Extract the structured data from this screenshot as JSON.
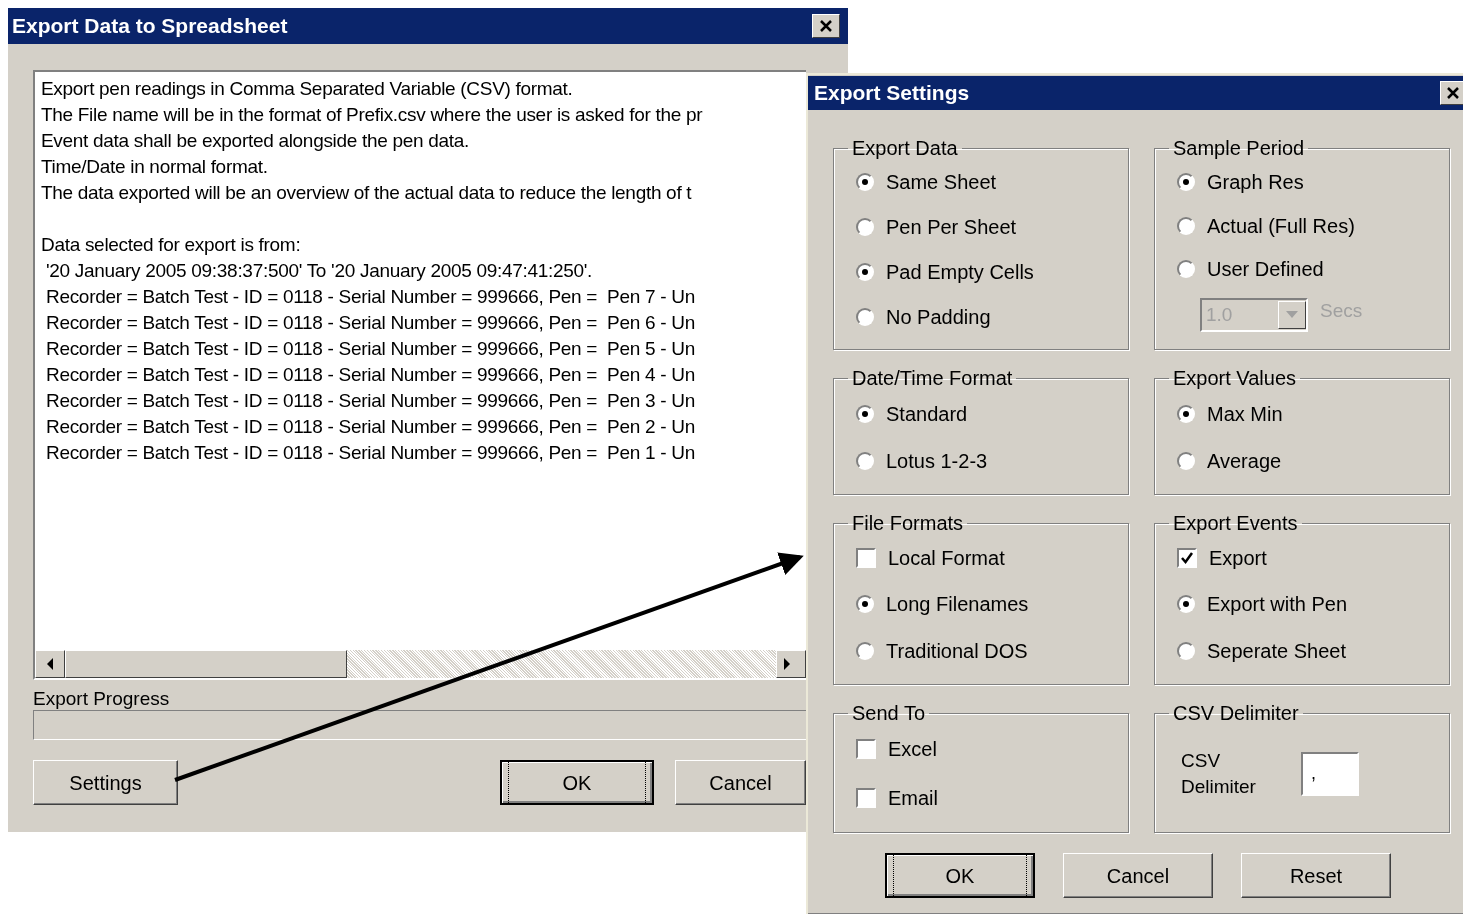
{
  "export_dialog": {
    "title": "Export Data to Spreadsheet",
    "description_lines": [
      "Export pen readings in Comma Separated Variable (CSV) format.",
      "The File name will be in the format of Prefix.csv where the user is asked for the pr",
      "Event data shall be exported alongside the pen data.",
      "Time/Date in normal format.",
      "The data exported will be an overview of the actual data to reduce the length of t"
    ],
    "selection_lines": [
      "Data selected for export is from:",
      " '20 January 2005 09:38:37:500' To '20 January 2005 09:47:41:250'.",
      " Recorder = Batch Test - ID = 0118 - Serial Number = 999666, Pen =  Pen 7 - Un",
      " Recorder = Batch Test - ID = 0118 - Serial Number = 999666, Pen =  Pen 6 - Un",
      " Recorder = Batch Test - ID = 0118 - Serial Number = 999666, Pen =  Pen 5 - Un",
      " Recorder = Batch Test - ID = 0118 - Serial Number = 999666, Pen =  Pen 4 - Un",
      " Recorder = Batch Test - ID = 0118 - Serial Number = 999666, Pen =  Pen 3 - Un",
      " Recorder = Batch Test - ID = 0118 - Serial Number = 999666, Pen =  Pen 2 - Un",
      " Recorder = Batch Test - ID = 0118 - Serial Number = 999666, Pen =  Pen 1 - Un"
    ],
    "progress_label": "Export Progress",
    "progress": {
      "level": 0
    },
    "buttons": [
      {
        "label": "Settings",
        "default": false
      },
      {
        "label": "OK",
        "default": true
      },
      {
        "label": "Cancel",
        "default": false
      }
    ]
  },
  "settings_dialog": {
    "title": "Export Settings",
    "groups": [
      {
        "title": "Export Data",
        "items": [
          {
            "kind": "radio",
            "label": "Same Sheet",
            "checked": true
          },
          {
            "kind": "radio",
            "label": "Pen Per Sheet",
            "checked": false
          },
          {
            "kind": "radio",
            "label": "Pad Empty Cells",
            "checked": true
          },
          {
            "kind": "radio",
            "label": "No Padding",
            "checked": false
          }
        ]
      },
      {
        "title": "Sample Period",
        "items": [
          {
            "kind": "radio",
            "label": "Graph Res",
            "checked": true
          },
          {
            "kind": "radio",
            "label": "Actual (Full Res)",
            "checked": false
          },
          {
            "kind": "radio",
            "label": "User Defined",
            "checked": false
          },
          {
            "kind": "dropdown",
            "value": "1.0",
            "unit": "Secs",
            "disabled": true
          }
        ]
      },
      {
        "title": "Date/Time Format",
        "items": [
          {
            "kind": "radio",
            "label": "Standard",
            "checked": true
          },
          {
            "kind": "radio",
            "label": "Lotus 1-2-3",
            "checked": false
          }
        ]
      },
      {
        "title": "Export Values",
        "items": [
          {
            "kind": "radio",
            "label": "Max Min",
            "checked": true
          },
          {
            "kind": "radio",
            "label": "Average",
            "checked": false
          }
        ]
      },
      {
        "title": "File Formats",
        "items": [
          {
            "kind": "checkbox",
            "label": "Local Format",
            "checked": false
          },
          {
            "kind": "radio",
            "label": "Long Filenames",
            "checked": true
          },
          {
            "kind": "radio",
            "label": "Traditional DOS",
            "checked": false
          }
        ]
      },
      {
        "title": "Export Events",
        "items": [
          {
            "kind": "checkbox",
            "label": "Export",
            "checked": true
          },
          {
            "kind": "radio",
            "label": "Export with Pen",
            "checked": true
          },
          {
            "kind": "radio",
            "label": "Seperate Sheet",
            "checked": false
          }
        ]
      },
      {
        "title": "Send To",
        "items": [
          {
            "kind": "checkbox",
            "label": "Excel",
            "checked": false
          },
          {
            "kind": "checkbox",
            "label": "Email",
            "checked": false
          }
        ]
      },
      {
        "title": "CSV Delimiter",
        "items": [
          {
            "kind": "text_field",
            "label": "CSV Delimiter",
            "value": ","
          }
        ]
      }
    ],
    "buttons": [
      {
        "label": "OK",
        "default": true
      },
      {
        "label": "Cancel",
        "default": false
      },
      {
        "label": "Reset",
        "default": false
      }
    ]
  }
}
